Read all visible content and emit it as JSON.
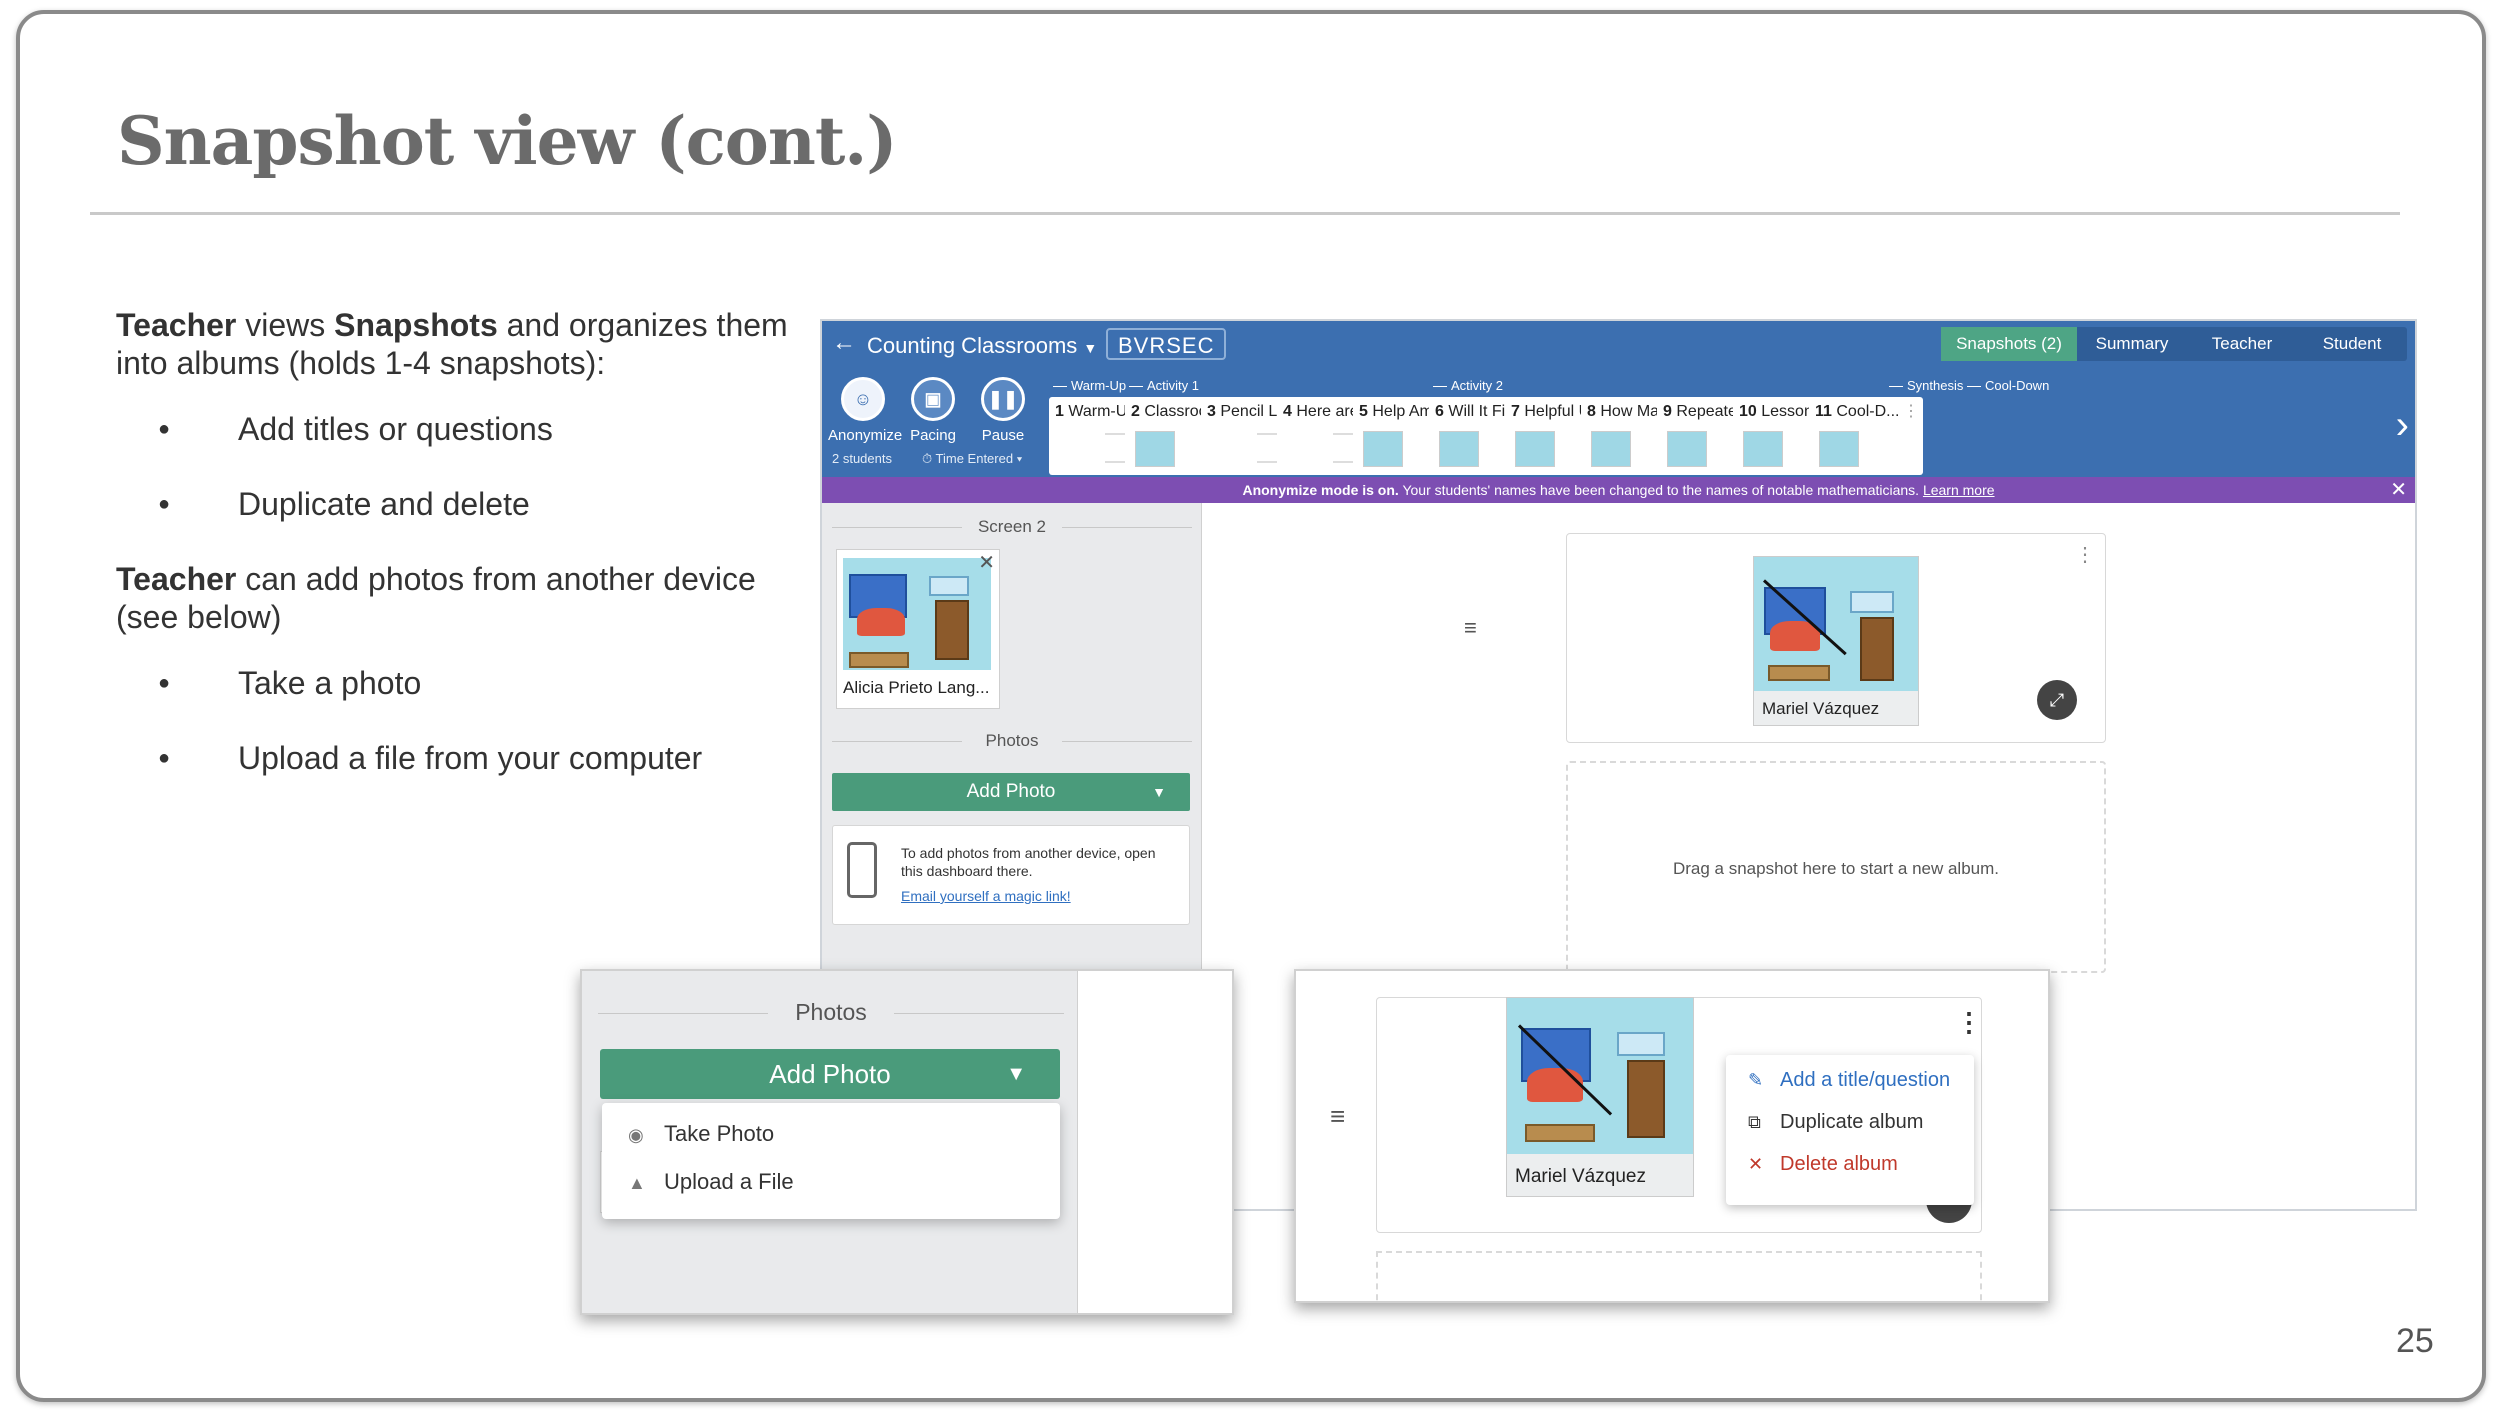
{
  "slide": {
    "title": "Snapshot view (cont.)",
    "page_number": "25"
  },
  "left_text": {
    "p1_bold1": "Teacher",
    "p1_mid": " views ",
    "p1_bold2": "Snapshots",
    "p1_rest": " and organizes them into albums (holds 1-4 snapshots):",
    "bullets1": [
      "Add titles or questions",
      "Duplicate and delete"
    ],
    "p2_bold": "Teacher",
    "p2_rest": " can add photos from another device (see below)",
    "bullets2": [
      "Take a photo",
      "Upload a file from your computer"
    ]
  },
  "app": {
    "class_name": "Counting Classrooms",
    "class_code": "BVRSEC",
    "view_tabs": [
      "Snapshots (2)",
      "Summary",
      "Teacher",
      "Student"
    ],
    "tools": [
      "Anonymize",
      "Pacing",
      "Pause"
    ],
    "tool_sub_students": "2 students",
    "tool_sub_time": "Time Entered",
    "sections": [
      "Warm-Up",
      "Activity 1",
      "Activity 2",
      "Synthesis",
      "Cool-Down"
    ],
    "screens": [
      {
        "num": "1",
        "label": "Warm-Up"
      },
      {
        "num": "2",
        "label": "Classroo..."
      },
      {
        "num": "3",
        "label": "Pencil Le..."
      },
      {
        "num": "4",
        "label": "Here are ..."
      },
      {
        "num": "5",
        "label": "Help Am..."
      },
      {
        "num": "6",
        "label": "Will It Fit?"
      },
      {
        "num": "7",
        "label": "Helpful U..."
      },
      {
        "num": "8",
        "label": "How Ma..."
      },
      {
        "num": "9",
        "label": "Repeate..."
      },
      {
        "num": "10",
        "label": "Lesson ..."
      },
      {
        "num": "11",
        "label": "Cool-D..."
      }
    ],
    "banner_bold": "Anonymize mode is on.",
    "banner_text": " Your students' names have been changed to the names of notable mathematicians. ",
    "banner_link": "Learn more",
    "sidebar": {
      "screen_label": "Screen 2",
      "snapshot_name": "Alicia Prieto Lang...",
      "photos_label": "Photos",
      "add_photo": "Add Photo",
      "device_note": "To add photos from another device, open this dashboard there.",
      "magic_link": "Email yourself a magic link!"
    },
    "album": {
      "student_name": "Mariel Vázquez",
      "drop_text": "Drag a snapshot here to start a new album."
    }
  },
  "callout_left": {
    "photos_label": "Photos",
    "add_photo": "Add Photo",
    "menu": [
      {
        "icon": "camera-icon",
        "label": "Take Photo"
      },
      {
        "icon": "image-icon",
        "label": "Upload a File"
      }
    ]
  },
  "callout_right": {
    "student_name": "Mariel Vázquez",
    "menu": [
      {
        "icon": "pencil-icon",
        "label": "Add a title/question"
      },
      {
        "icon": "duplicate-icon",
        "label": "Duplicate album"
      },
      {
        "icon": "close-icon",
        "label": "Delete album"
      }
    ]
  },
  "colors": {
    "app_blue": "#3c6fb0",
    "green": "#4a9b7b",
    "purple_banner": "#7d4eb2",
    "delete_red": "#c0392b"
  }
}
